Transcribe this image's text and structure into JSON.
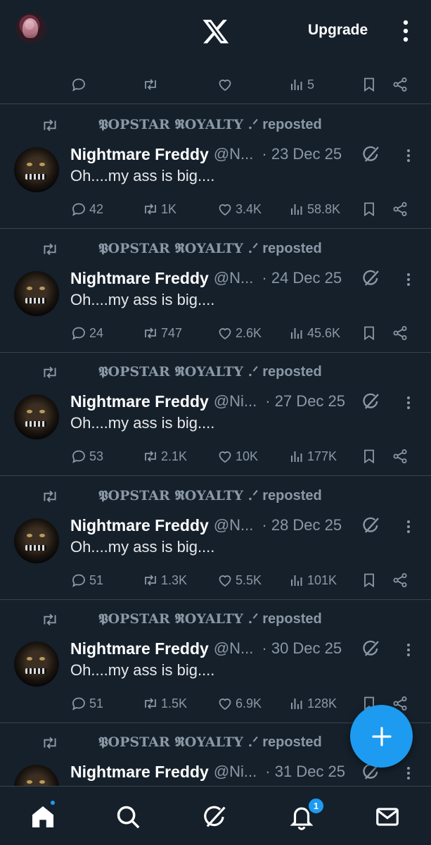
{
  "header": {
    "upgrade_label": "Upgrade",
    "logo_icon": "x-logo-icon",
    "menu_icon": "kebab-menu-icon"
  },
  "first_post_actions": {
    "views": "5"
  },
  "posts": [
    {
      "reposter": "𝕻OPSTAR 𝕽OYALTY .ᐟ",
      "reposted_label": "reposted",
      "name": "Nightmare Freddy",
      "handle": "@N...",
      "date": "· 23 Dec 25",
      "text": "Oh....my ass is big....",
      "replies": "42",
      "reposts": "1K",
      "likes": "3.4K",
      "views": "58.8K"
    },
    {
      "reposter": "𝕻OPSTAR 𝕽OYALTY .ᐟ",
      "reposted_label": "reposted",
      "name": "Nightmare Freddy",
      "handle": "@N...",
      "date": "· 24 Dec 25",
      "text": "Oh....my ass is big....",
      "replies": "24",
      "reposts": "747",
      "likes": "2.6K",
      "views": "45.6K"
    },
    {
      "reposter": "𝕻OPSTAR 𝕽OYALTY .ᐟ",
      "reposted_label": "reposted",
      "name": "Nightmare Freddy",
      "handle": "@Ni...",
      "date": "· 27 Dec 25",
      "text": "Oh....my ass is big....",
      "replies": "53",
      "reposts": "2.1K",
      "likes": "10K",
      "views": "177K"
    },
    {
      "reposter": "𝕻OPSTAR 𝕽OYALTY .ᐟ",
      "reposted_label": "reposted",
      "name": "Nightmare Freddy",
      "handle": "@N...",
      "date": "· 28 Dec 25",
      "text": "Oh....my ass is big....",
      "replies": "51",
      "reposts": "1.3K",
      "likes": "5.5K",
      "views": "101K"
    },
    {
      "reposter": "𝕻OPSTAR 𝕽OYALTY .ᐟ",
      "reposted_label": "reposted",
      "name": "Nightmare Freddy",
      "handle": "@N...",
      "date": "· 30 Dec 25",
      "text": "Oh....my ass is big....",
      "replies": "51",
      "reposts": "1.5K",
      "likes": "6.9K",
      "views": "128K"
    },
    {
      "reposter": "𝕻OPSTAR 𝕽OYALTY .ᐟ",
      "reposted_label": "reposted",
      "name": "Nightmare Freddy",
      "handle": "@Ni...",
      "date": "· 31 Dec 25",
      "text": "",
      "replies": "",
      "reposts": "",
      "likes": "",
      "views": ""
    }
  ],
  "bottom_nav": {
    "items": [
      "home-icon",
      "search-icon",
      "grok-icon",
      "notifications-icon",
      "messages-icon"
    ],
    "notification_count": "1"
  },
  "colors": {
    "background": "#15202b",
    "accent": "#1d9bf0",
    "muted": "#8b98a5",
    "divider": "#38444d"
  }
}
